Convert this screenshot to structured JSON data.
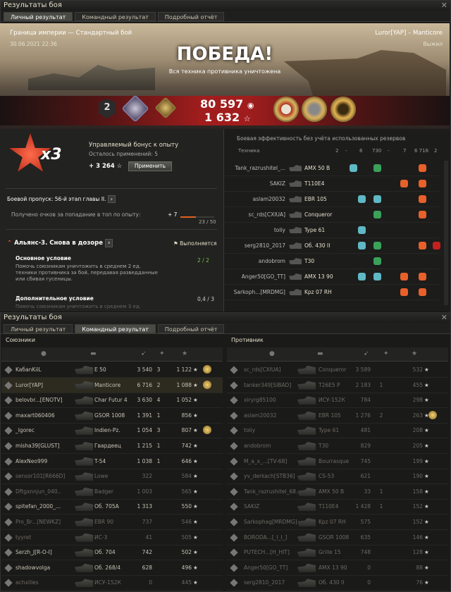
{
  "window1": {
    "title": "Результаты боя",
    "tabs": [
      "Личный результат",
      "Командный результат",
      "Подробный отчёт"
    ],
    "active_tab": 0
  },
  "hero": {
    "map": "Граница империи — Стандартный бой",
    "date": "30.06.2021 22:36",
    "player": "Luror[YAP] – Manticore",
    "exit": "Выжил",
    "result": "ПОБЕДА!",
    "result_sub": "Вся техника противника уничтожена",
    "credits": "80 597",
    "xp": "1 632",
    "rank": "2"
  },
  "bonus": {
    "multiplier": "x3",
    "title": "Управляемый бонус к опыту",
    "uses_left": "Осталось применений: 5",
    "value": "+ 3 264",
    "apply_label": "Применить"
  },
  "battle_pass": {
    "title": "Боевой пропуск: 56-й этап главы II.",
    "row_label": "Получено очков за попадание в топ по опыту:",
    "row_value": "+ 7",
    "progress": "23 / 50",
    "progress_fraction": 0.46
  },
  "operation": {
    "title": "Альянс-3. Снова в дозоре",
    "status": "Выполняется",
    "main_label": "Основное условие",
    "main_text": "Помочь союзникам уничтожить в среднем 2 ед. техники противника за бой, передавая разведданные или сбивая гусеницы.",
    "main_value": "2 / 2",
    "extra_label": "Дополнительное условие",
    "extra_text": "Помочь союзникам уничтожить в среднем 3 ед.",
    "extra_value": "0,4 / 3"
  },
  "efficiency": {
    "title": "Боевая эффективность без учёта использованных резервов",
    "col_vehicle": "Техника",
    "col_values": [
      "2",
      "-",
      "6",
      "730",
      "-",
      "7",
      "6 716",
      "2"
    ],
    "rows": [
      {
        "player": "Tank_razrushitel_...",
        "vehicle": "AMX 50 B"
      },
      {
        "player": "SAKIZ",
        "vehicle": "T110E4"
      },
      {
        "player": "aslam20032",
        "vehicle": "EBR 105"
      },
      {
        "player": "sc_rds[CXIUA]",
        "vehicle": "Conqueror"
      },
      {
        "player": "toliy",
        "vehicle": "Type 61"
      },
      {
        "player": "serg2810_2017",
        "vehicle": "Об. 430 II"
      },
      {
        "player": "andobrom",
        "vehicle": "T30"
      },
      {
        "player": "Anger50[GO_TT]",
        "vehicle": "AMX 13 90"
      },
      {
        "player": "Sarkoph...[MRDMG]",
        "vehicle": "Kpz 07 RH"
      }
    ]
  },
  "window2": {
    "title": "Результаты боя",
    "tabs": [
      "Личный результат",
      "Командный результат",
      "Подробный отчёт"
    ],
    "active_tab": 1
  },
  "allies": {
    "label": "Союзники",
    "rows": [
      {
        "name": "KaбanKiiL",
        "vehicle": "E 50",
        "damage": "3 540",
        "kills": "3",
        "xp": "1 122",
        "medal": true
      },
      {
        "name": "Luror[YAP]",
        "vehicle": "Manticore",
        "damage": "6 716",
        "kills": "2",
        "xp": "1 088",
        "medal": true,
        "self": true
      },
      {
        "name": "belovbr...[ENOTV]",
        "vehicle": "Char Futur 4",
        "damage": "3 630",
        "kills": "4",
        "xp": "1 052",
        "medal": false
      },
      {
        "name": "maxart060406",
        "vehicle": "GSOR 1008",
        "damage": "1 391",
        "kills": "1",
        "xp": "856",
        "medal": false
      },
      {
        "name": "_lgorec",
        "vehicle": "Indien-Pz.",
        "damage": "1 054",
        "kills": "3",
        "xp": "807",
        "medal": true
      },
      {
        "name": "misha39[GLUST]",
        "vehicle": "Гвардеец",
        "damage": "1 215",
        "kills": "1",
        "xp": "742",
        "medal": false
      },
      {
        "name": "AlexNeo999",
        "vehicle": "T-54",
        "damage": "1 038",
        "kills": "1",
        "xp": "646",
        "medal": false
      },
      {
        "name": "sensor101[R666D]",
        "vehicle": "Lowe",
        "damage": "322",
        "kills": "",
        "xp": "584",
        "medal": false,
        "dead": true
      },
      {
        "name": "Dftgxnnjun_040..",
        "vehicle": "Badger",
        "damage": "1 003",
        "kills": "",
        "xp": "565",
        "medal": false,
        "dead": true
      },
      {
        "name": "spitefan_2000_...",
        "vehicle": "Об. 705А",
        "damage": "1 313",
        "kills": "",
        "xp": "550",
        "medal": false
      },
      {
        "name": "Pro_Br...[NEWKZ]",
        "vehicle": "EBR 90",
        "damage": "737",
        "kills": "",
        "xp": "546",
        "medal": false,
        "dead": true
      },
      {
        "name": "tyyret",
        "vehicle": "ИС-3",
        "damage": "41",
        "kills": "",
        "xp": "505",
        "medal": false,
        "dead": true
      },
      {
        "name": "Serzh_J[R-O-I]",
        "vehicle": "Об. 704",
        "damage": "742",
        "kills": "",
        "xp": "502",
        "medal": false
      },
      {
        "name": "shadowvolga",
        "vehicle": "Об. 268/4",
        "damage": "628",
        "kills": "",
        "xp": "496",
        "medal": false
      },
      {
        "name": "achxilles",
        "vehicle": "ИСУ-152К",
        "damage": "0",
        "kills": "",
        "xp": "445",
        "medal": false,
        "dead": true
      }
    ]
  },
  "enemies": {
    "label": "Противник",
    "rows": [
      {
        "name": "sc_rds[CXIUA]",
        "vehicle": "Conqueror",
        "damage": "3 589",
        "kills": "",
        "xp": "532",
        "medal": false,
        "dead": true
      },
      {
        "name": "tanker349[SIBAD]",
        "vehicle": "T26E5 P",
        "damage": "2 183",
        "kills": "1",
        "xp": "455",
        "medal": false,
        "dead": true
      },
      {
        "name": "xiryrg85100",
        "vehicle": "ИСУ-152К",
        "damage": "784",
        "kills": "",
        "xp": "298",
        "medal": false,
        "dead": true
      },
      {
        "name": "aslam20032",
        "vehicle": "EBR 105",
        "damage": "1 276",
        "kills": "2",
        "xp": "263",
        "medal": true,
        "dead": true
      },
      {
        "name": "toliy",
        "vehicle": "Type 61",
        "damage": "481",
        "kills": "",
        "xp": "208",
        "medal": false,
        "dead": true
      },
      {
        "name": "andobrom",
        "vehicle": "T30",
        "damage": "829",
        "kills": "",
        "xp": "205",
        "medal": false,
        "dead": true
      },
      {
        "name": "M_a_x_...[TV-68]",
        "vehicle": "Bourrasque",
        "damage": "745",
        "kills": "",
        "xp": "199",
        "medal": false,
        "dead": true
      },
      {
        "name": "yv_derkach[STB36]",
        "vehicle": "CS-53",
        "damage": "621",
        "kills": "",
        "xp": "190",
        "medal": false,
        "dead": true
      },
      {
        "name": "Tank_razrushitel_68..",
        "vehicle": "AMX 50 B",
        "damage": "33",
        "kills": "1",
        "xp": "158",
        "medal": false,
        "dead": true
      },
      {
        "name": "SAKIZ",
        "vehicle": "T110E4",
        "damage": "1 428",
        "kills": "1",
        "xp": "152",
        "medal": false,
        "dead": true
      },
      {
        "name": "Sarkophag[MRDMG]",
        "vehicle": "Kpz 07 RH",
        "damage": "575",
        "kills": "",
        "xp": "152",
        "medal": false,
        "dead": true
      },
      {
        "name": "BORODA...[_I_I_]",
        "vehicle": "GSOR 1008",
        "damage": "635",
        "kills": "",
        "xp": "146",
        "medal": false,
        "dead": true
      },
      {
        "name": "PUTECH...[H_HIT]",
        "vehicle": "Grille 15",
        "damage": "748",
        "kills": "",
        "xp": "128",
        "medal": false,
        "dead": true
      },
      {
        "name": "Anger50[GO_TT]",
        "vehicle": "AMX 13 90",
        "damage": "0",
        "kills": "",
        "xp": "88",
        "medal": false,
        "dead": true
      },
      {
        "name": "serg2810_2017",
        "vehicle": "Об. 430 II",
        "damage": "0",
        "kills": "",
        "xp": "76",
        "medal": false,
        "dead": true
      }
    ]
  }
}
